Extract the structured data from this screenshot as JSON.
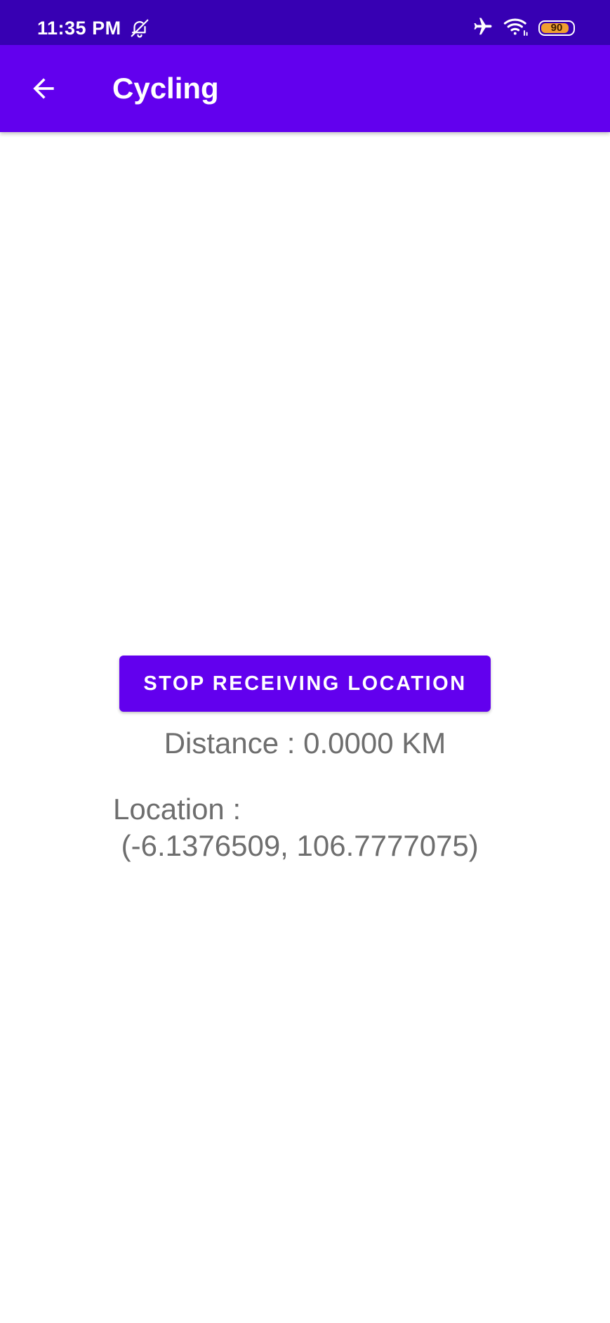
{
  "status_bar": {
    "time": "11:35 PM",
    "left_icon": "alarm-off-icon",
    "right_icons": [
      "airplane-mode-icon",
      "wifi-icon",
      "battery-icon"
    ],
    "battery_level": "90",
    "battery_fraction": 0.9,
    "background_color": "#3700b3"
  },
  "app_bar": {
    "back_icon": "arrow-back-icon",
    "title": "Cycling",
    "background_color": "#6200ee"
  },
  "main": {
    "stop_button_label": "STOP RECEIVING LOCATION",
    "distance_text": "Distance : 0.0000 KM",
    "location_label": "Location :",
    "location_value": " (-6.1376509, 106.7777075)",
    "text_color": "#6e6e6e"
  }
}
